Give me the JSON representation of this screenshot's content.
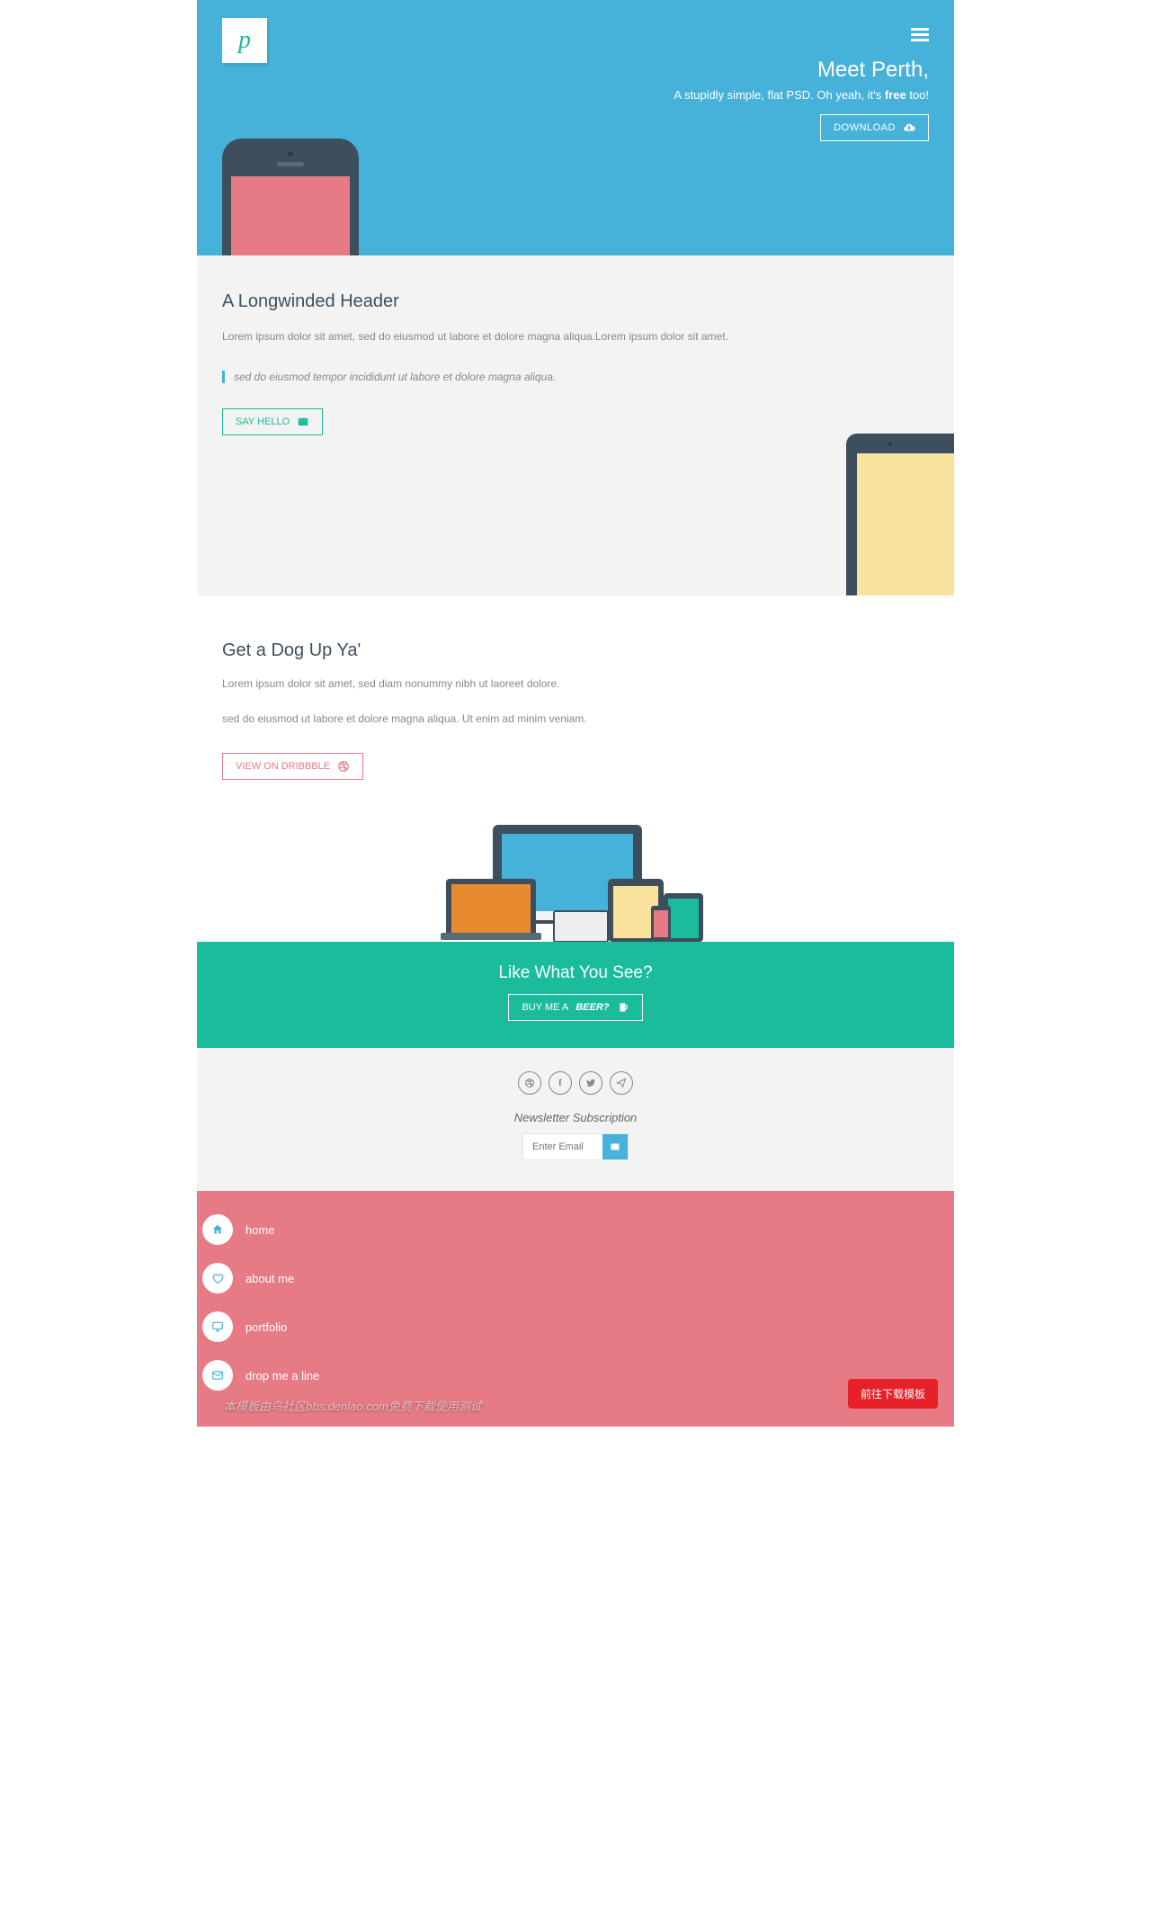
{
  "hero": {
    "title": "Meet Perth,",
    "subtitle_a": "A stupidly simple, flat PSD. Oh yeah, it's ",
    "subtitle_b": "free",
    "subtitle_c": " too!",
    "download": "DOWNLOAD"
  },
  "section1": {
    "title": "A Longwinded Header",
    "body": "Lorem ipsum dolor sit amet, sed do eiusmod ut labore et dolore magna aliqua.Lorem ipsum dolor sit amet.",
    "quote": "sed do eiusmod tempor incididunt ut labore et dolore magna aliqua.",
    "btn": "SAY HELLO"
  },
  "section2": {
    "title": "Get a Dog Up Ya'",
    "body1": "Lorem ipsum dolor sit amet, sed diam nonummy nibh ut laoreet dolore.",
    "body2": "sed do eiusmod ut labore et dolore magna aliqua. Ut enim ad minim veniam.",
    "btn": "VIEW ON DRIBBBLE"
  },
  "cta": {
    "title": "Like What You See?",
    "btn_a": "BUY ME A ",
    "btn_b": "BEER?"
  },
  "footer": {
    "newsletter_label": "Newsletter Subscription",
    "placeholder": "Enter Email"
  },
  "nav": {
    "items": [
      {
        "label": "home"
      },
      {
        "label": "about me"
      },
      {
        "label": "portfolio"
      },
      {
        "label": "drop me a line"
      }
    ]
  },
  "watermark": "本模板由鸟社区bbs.denlao.com免费下载使用测试",
  "float_btn": "前往下载模板"
}
